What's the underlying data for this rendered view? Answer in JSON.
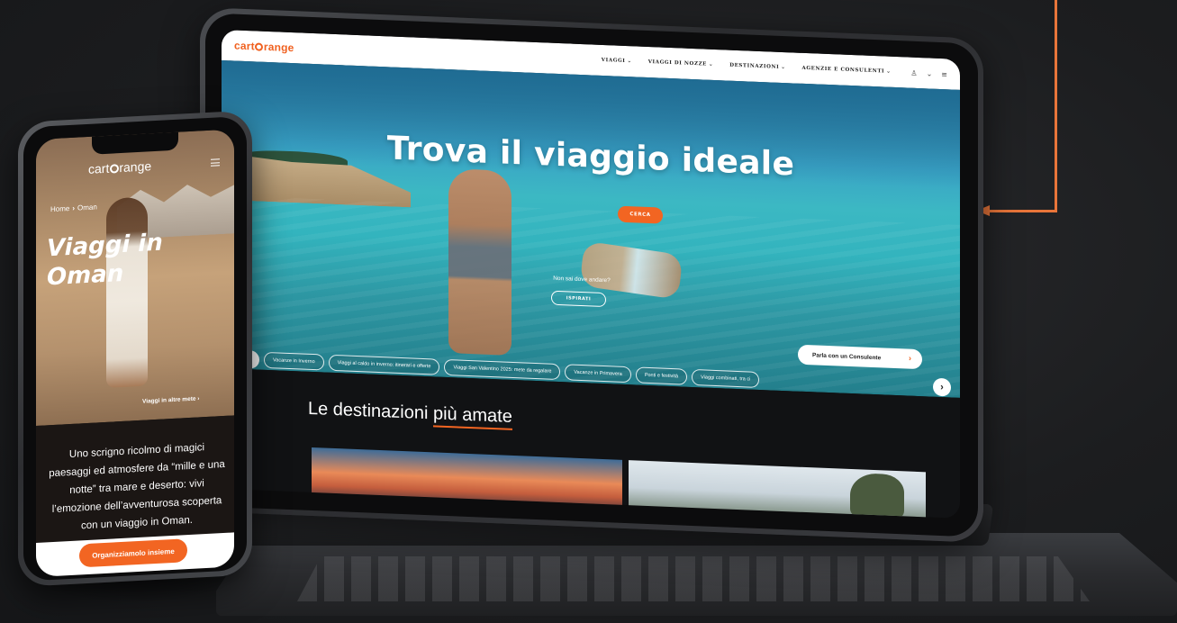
{
  "tablet": {
    "site": {
      "logo_text": "cart",
      "logo_suffix": "range",
      "nav": [
        {
          "label": "VIAGGI"
        },
        {
          "label": "VIAGGI DI NOZZE"
        },
        {
          "label": "DESTINAZIONI"
        },
        {
          "label": "AGENZIE E CONSULENTI"
        }
      ],
      "nav_icons": [
        "user-icon",
        "chevron-down-icon",
        "menu-icon"
      ]
    },
    "hero": {
      "title": "Trova il viaggio ideale",
      "search_button": "CERCA",
      "question": "Non sai dove andare?",
      "inspire_button": "ISPIRATI",
      "consultant_button": "Parla con un Consulente",
      "chips": [
        "Vacanze in Inverno",
        "Viaggi al caldo in inverno: itinerari e offerte",
        "Viaggi San Valentino 2025: mete da regalare",
        "Vacanze in Primavera",
        "Ponti e festività",
        "Viaggi combinati, tra ci"
      ]
    },
    "section": {
      "heading_pre": "Le destinazioni ",
      "heading_accent": "più amate"
    }
  },
  "phone": {
    "logo_text": "cart",
    "logo_suffix": "range",
    "breadcrumb": {
      "home": "Home",
      "sep": "›",
      "current": "Oman"
    },
    "title_line1": "Viaggi in",
    "title_line2": "Oman",
    "link": "Viaggi in altre mete ›",
    "description": "Uno scrigno ricolmo di magici paesaggi ed atmosfere da “mille e una notte” tra mare e deserto: vivi l’emozione dell’avventurosa scoperta con un viaggio in Oman.",
    "cta_button": "Organizziamolo insieme"
  },
  "colors": {
    "accent": "#f26522",
    "connector": "#e8753a",
    "background": "#1c1d1f"
  }
}
